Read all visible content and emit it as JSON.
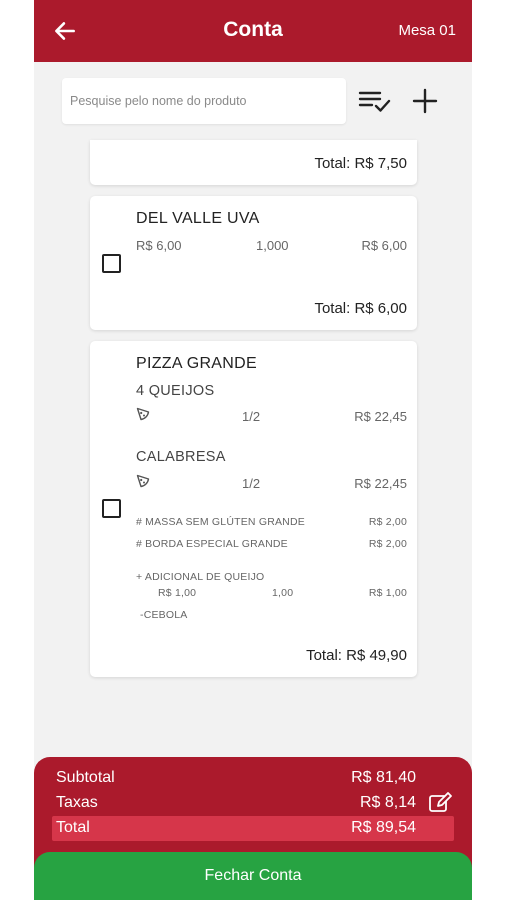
{
  "header": {
    "title": "Conta",
    "table": "Mesa 01"
  },
  "search": {
    "placeholder": "Pesquise pelo nome do produto"
  },
  "items": {
    "partial_total": "Total: R$ 7,50",
    "del_valle": {
      "name": "DEL VALLE UVA",
      "unit_price": "R$ 6,00",
      "qty": "1,000",
      "price": "R$ 6,00",
      "total": "Total: R$ 6,00"
    },
    "pizza": {
      "name": "PIZZA GRANDE",
      "flavor1": "4 QUEIJOS",
      "flavor1_qty": "1/2",
      "flavor1_price": "R$ 22,45",
      "flavor2": "CALABRESA",
      "flavor2_qty": "1/2",
      "flavor2_price": "R$ 22,45",
      "mod1": "# MASSA SEM GLÚTEN GRANDE",
      "mod1_price": "R$ 2,00",
      "mod2": "# BORDA ESPECIAL  GRANDE",
      "mod2_price": "R$ 2,00",
      "addon": "+ ADICIONAL DE QUEIJO",
      "addon_unit": "R$ 1,00",
      "addon_qty": "1,00",
      "addon_price": "R$ 1,00",
      "removal": "-CEBOLA",
      "total": "Total: R$ 49,90"
    }
  },
  "summary": {
    "subtotal_label": "Subtotal",
    "subtotal_value": "R$ 81,40",
    "taxes_label": "Taxas",
    "taxes_value": "R$ 8,14",
    "total_label": "Total",
    "total_value": "R$ 89,54"
  },
  "close_button": "Fechar Conta",
  "icons": {
    "back": "arrow-left-icon",
    "checklist": "checklist-icon",
    "add": "plus-icon",
    "pizza": "pizza-slice-icon",
    "edit": "edit-icon"
  },
  "colors": {
    "primary": "#ab1a2c",
    "total_highlight": "#d6364a",
    "confirm": "#27a342",
    "background": "#f2f2f2"
  }
}
